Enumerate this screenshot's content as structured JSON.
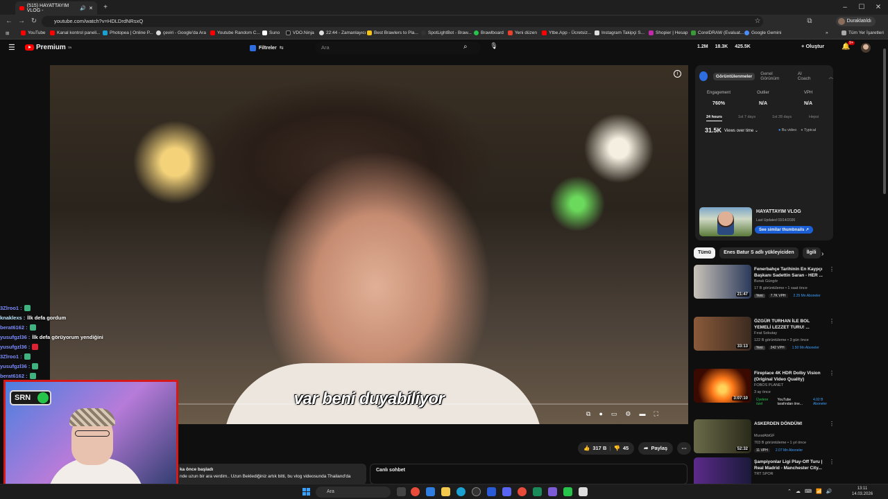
{
  "browser": {
    "tab_title": "(515) HAYATTAYIM VLOG -",
    "url": "youtube.com/watch?v=HDLDrdNRsxQ",
    "profile": "Duraklatıldı",
    "bookmarks": [
      "YouTube",
      "Kanal kontrol paneli...",
      "Photopea | Online P...",
      "çeviri - Google'da Ara",
      "Youtube Random C...",
      "Suno",
      "VDO.Ninja",
      "22:44 - Zamanlayıcı",
      "Best Brawlers to Pla...",
      "SpotLightBot - Braw...",
      "Brawlboard",
      "Yeni düzen",
      "Ytbe.App - Ücretsiz...",
      "Instagram Takipçi S...",
      "Shopier | Hesap",
      "CorelDRAW (Evaluat...",
      "Google Gemini"
    ],
    "all_bookmarks": "Tüm Yer İşaretleri"
  },
  "youtube": {
    "logo": "Premium",
    "logo_sup": "TR",
    "filters": "Filtreler",
    "search_placeholder": "Ara",
    "stats": [
      "1.2M",
      "18.3K",
      "425.5K"
    ],
    "create": "Oluştur",
    "notif_badge": "9+"
  },
  "video": {
    "subtitle": "var beni duyabiliyor",
    "progress_fraction": 0.2
  },
  "actions": {
    "likes": "317 B",
    "dislikes": "45",
    "share": "Paylaş"
  },
  "description": {
    "line1": "ka önce başladı",
    "line2": "nde uzun bir ara verdim.. Uzun Beklediğiniz artık bitti, bu vlog videosunda Thailand'da"
  },
  "live_chat": {
    "title": "Canlı sohbet"
  },
  "analytics": {
    "tabs": [
      "Görüntülenmeler",
      "Genel Görünüm",
      "AI Coach"
    ],
    "metrics": [
      {
        "label": "Engagement",
        "value": "760%"
      },
      {
        "label": "Outlier",
        "value": "N/A"
      },
      {
        "label": "VPH",
        "value": "N/A"
      }
    ],
    "ranges": [
      "24 hours",
      "1st 7 days",
      "1st 28 days",
      "Hepsi"
    ],
    "views_total": "31.5K",
    "views_select": "Views over time",
    "legend": [
      "Bu video",
      "Typical"
    ],
    "video_title": "HAYATTAYIM VLOG",
    "last_updated": "Last Updated 03/14/2026",
    "similar_btn": "See similar thumbnails"
  },
  "chips": [
    "Tümü",
    "Enes Batur S adlı yükleyiciden",
    "İlgili"
  ],
  "recommendations": [
    {
      "title": "Fenerbahçe Tarihinin En Kaypçı Başkanı Sadettin Saran - HER ...",
      "channel": "Burak Güngör",
      "meta": "17 B görüntüleme • 1 saat önce",
      "badge": "Yeni",
      "vph": "7.7K VPH",
      "extra": "2.25 Mn Aboneler",
      "duration": "21:47",
      "colors": [
        "#c9c2b8",
        "#2b3a5b"
      ]
    },
    {
      "title": "ÖZGÜR TURHAN İLE BOL YEMELİ LEZZET TURU! ...",
      "channel": "Fırat Sobutay",
      "meta": "122 B görüntüleme • 3 gün önce",
      "badge": "Yeni",
      "vph": "242 VPH",
      "extra": "1.50 Mn Aboneler",
      "duration": "33:13",
      "colors": [
        "#8a5a3a",
        "#3b2a20"
      ]
    },
    {
      "title": "Fireplace 4K HDR Dolby Vision (Original Video Quality)",
      "channel": "FOBOS PLANET",
      "meta": "3 ay önce",
      "badge": "Üyelere özel",
      "vph": "YouTube tarafından öne...",
      "extra": "4.02 B Aboneler",
      "duration": "3:07:10",
      "colors": [
        "#ff7a1a",
        "#3a0a00"
      ]
    },
    {
      "title": "ASKERDEN DÖNDÜM!",
      "channel": "MuratAbiGF",
      "meta": "703 B görüntüleme • 1 yıl önce",
      "badge": "",
      "vph": "11 VPH",
      "extra": "2.07 Mn Aboneler",
      "duration": "52:32",
      "colors": [
        "#6a6a4a",
        "#2a2a1a"
      ]
    },
    {
      "title": "Şampiyonlar Ligi Play-Off Turu | Real Madrid - Manchester City...",
      "channel": "TRT SPOR",
      "meta": "",
      "badge": "",
      "vph": "",
      "extra": "",
      "duration": "",
      "colors": [
        "#5b2a8a",
        "#1a1a3a"
      ]
    }
  ],
  "chat_overlay": [
    {
      "user": "3Zlroo1 :",
      "msg": ""
    },
    {
      "user": "knaklexs :",
      "msg": "İlk defa gordum"
    },
    {
      "user": "berat6162 :",
      "msg": ""
    },
    {
      "user": "yusufgzl36 :",
      "msg": "İlk defa görüyorum yendiğini"
    },
    {
      "user": "yusufgzl36 :",
      "msg": ""
    },
    {
      "user": "3Zlroo1 :",
      "msg": ""
    },
    {
      "user": "yusufgzl36 :",
      "msg": ""
    },
    {
      "user": "berat6162 :",
      "msg": ""
    }
  ],
  "webcam": {
    "logo": "SRN"
  },
  "taskbar": {
    "search": "Ara",
    "time": "13:11",
    "date": "14.03.2026"
  },
  "colors": {
    "accent_red": "#ff0000",
    "webcam_border": "#d61818",
    "chat_user": "#7d8dff"
  }
}
